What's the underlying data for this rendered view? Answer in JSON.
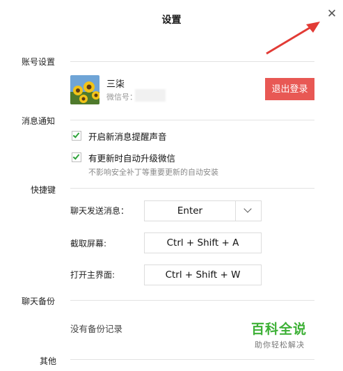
{
  "window": {
    "title": "设置",
    "close_glyph": "✕"
  },
  "account": {
    "section_label": "账号设置",
    "name": "三柒",
    "wechat_id_label": "微信号：",
    "logout_label": "退出登录",
    "avatar_icon": "sunflower-avatar"
  },
  "notifications": {
    "section_label": "消息通知",
    "items": [
      {
        "label": "开启新消息提醒声音",
        "checked": true
      },
      {
        "label": "有更新时自动升级微信",
        "checked": true
      }
    ],
    "hint": "不影响安全补丁等重要更新的自动安装"
  },
  "shortcuts": {
    "section_label": "快捷键",
    "send_label": "聊天发送消息：",
    "send_value": "Enter",
    "screenshot_label": "截取屏幕:",
    "screenshot_value": "Ctrl + Shift + A",
    "open_label": "打开主界面:",
    "open_value": "Ctrl + Shift + W"
  },
  "backup": {
    "section_label": "聊天备份",
    "empty_text": "没有备份记录"
  },
  "other": {
    "section_label": "其他"
  },
  "watermark": {
    "main": "百科全说",
    "sub": "助你轻松解决"
  },
  "colors": {
    "accent_red": "#e85854",
    "check_green": "#2ea33a",
    "arrow_red": "#e23b35",
    "watermark_green": "#3cb035"
  }
}
